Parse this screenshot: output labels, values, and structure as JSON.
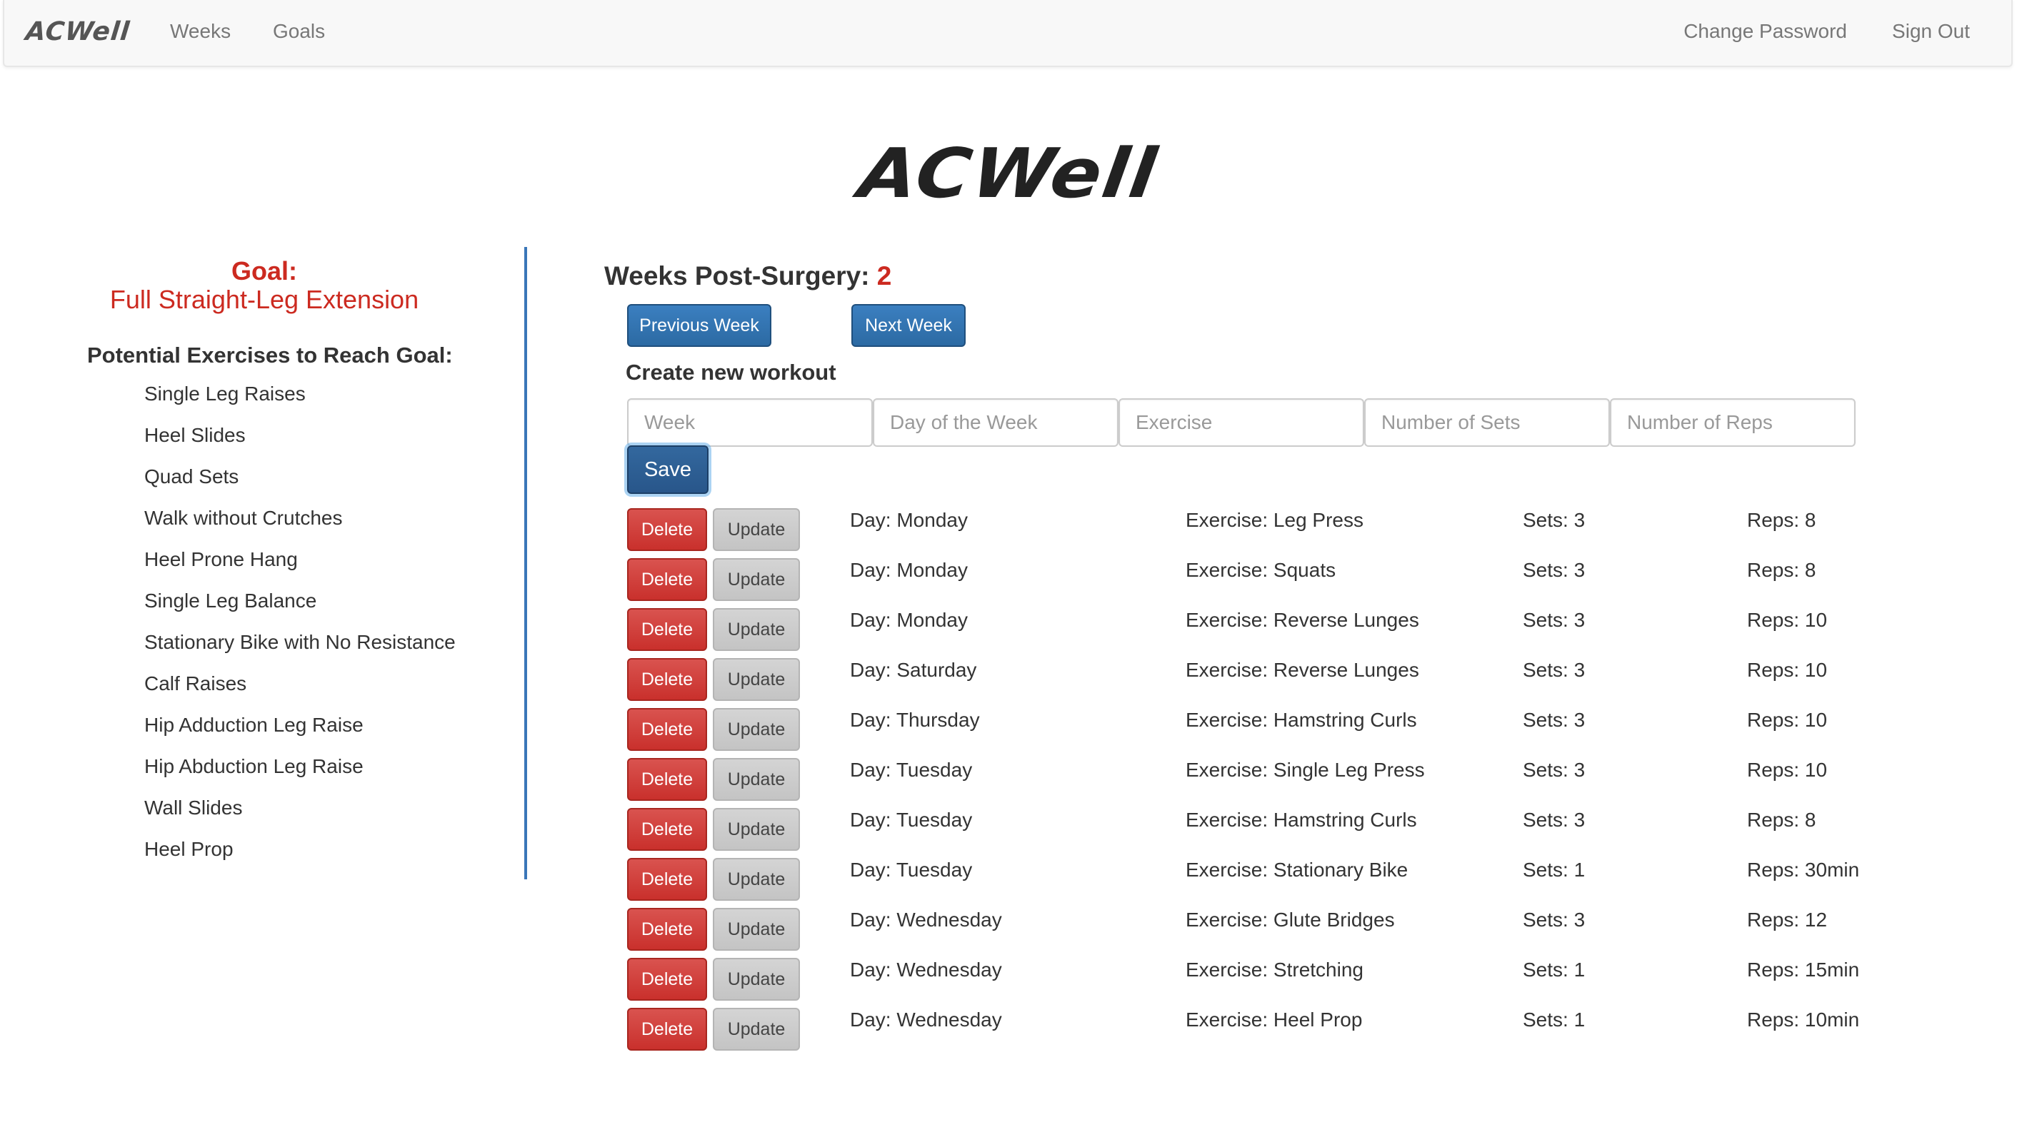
{
  "nav": {
    "brand": "ACWell",
    "weeks": "Weeks",
    "goals": "Goals",
    "change_password": "Change Password",
    "sign_out": "Sign Out"
  },
  "header": {
    "title": "ACWell"
  },
  "goal": {
    "label": "Goal:",
    "text": "Full Straight-Leg Extension",
    "potential_heading": "Potential Exercises to Reach Goal:",
    "exercises": [
      "Single Leg Raises",
      "Heel Slides",
      "Quad Sets",
      "Walk without Crutches",
      "Heel Prone Hang",
      "Single Leg Balance",
      "Stationary Bike with No Resistance",
      "Calf Raises",
      "Hip Adduction Leg Raise",
      "Hip Abduction Leg Raise",
      "Wall Slides",
      "Heel Prop"
    ]
  },
  "weeks": {
    "label": "Weeks Post-Surgery:",
    "value": "2",
    "prev_label": "Previous Week",
    "next_label": "Next Week"
  },
  "create": {
    "heading": "Create new workout",
    "week_placeholder": "Week",
    "day_placeholder": "Day of the Week",
    "exercise_placeholder": "Exercise",
    "sets_placeholder": "Number of Sets",
    "reps_placeholder": "Number of Reps",
    "save_label": "Save"
  },
  "workouts": {
    "delete_label": "Delete",
    "update_label": "Update",
    "rows": [
      {
        "day": "Day: Monday",
        "exercise": "Exercise: Leg Press",
        "sets": "Sets: 3",
        "reps": "Reps: 8"
      },
      {
        "day": "Day: Monday",
        "exercise": "Exercise: Squats",
        "sets": "Sets: 3",
        "reps": "Reps: 8"
      },
      {
        "day": "Day: Monday",
        "exercise": "Exercise: Reverse Lunges",
        "sets": "Sets: 3",
        "reps": "Reps: 10"
      },
      {
        "day": "Day: Saturday",
        "exercise": "Exercise: Reverse Lunges",
        "sets": "Sets: 3",
        "reps": "Reps: 10"
      },
      {
        "day": "Day: Thursday",
        "exercise": "Exercise: Hamstring Curls",
        "sets": "Sets: 3",
        "reps": "Reps: 10"
      },
      {
        "day": "Day: Tuesday",
        "exercise": "Exercise: Single Leg Press",
        "sets": "Sets: 3",
        "reps": "Reps: 10"
      },
      {
        "day": "Day: Tuesday",
        "exercise": "Exercise: Hamstring Curls",
        "sets": "Sets: 3",
        "reps": "Reps: 8"
      },
      {
        "day": "Day: Tuesday",
        "exercise": "Exercise: Stationary Bike",
        "sets": "Sets: 1",
        "reps": "Reps: 30min"
      },
      {
        "day": "Day: Wednesday",
        "exercise": "Exercise: Glute Bridges",
        "sets": "Sets: 3",
        "reps": "Reps: 12"
      },
      {
        "day": "Day: Wednesday",
        "exercise": "Exercise: Stretching",
        "sets": "Sets: 1",
        "reps": "Reps: 15min"
      },
      {
        "day": "Day: Wednesday",
        "exercise": "Exercise: Heel Prop",
        "sets": "Sets: 1",
        "reps": "Reps: 10min"
      }
    ]
  },
  "colors": {
    "accent_red": "#cc2a20",
    "primary_blue": "#337ab7",
    "divider_blue": "#3a76b8",
    "danger_red": "#d9534f",
    "neutral_gray": "#c8c8c8"
  }
}
